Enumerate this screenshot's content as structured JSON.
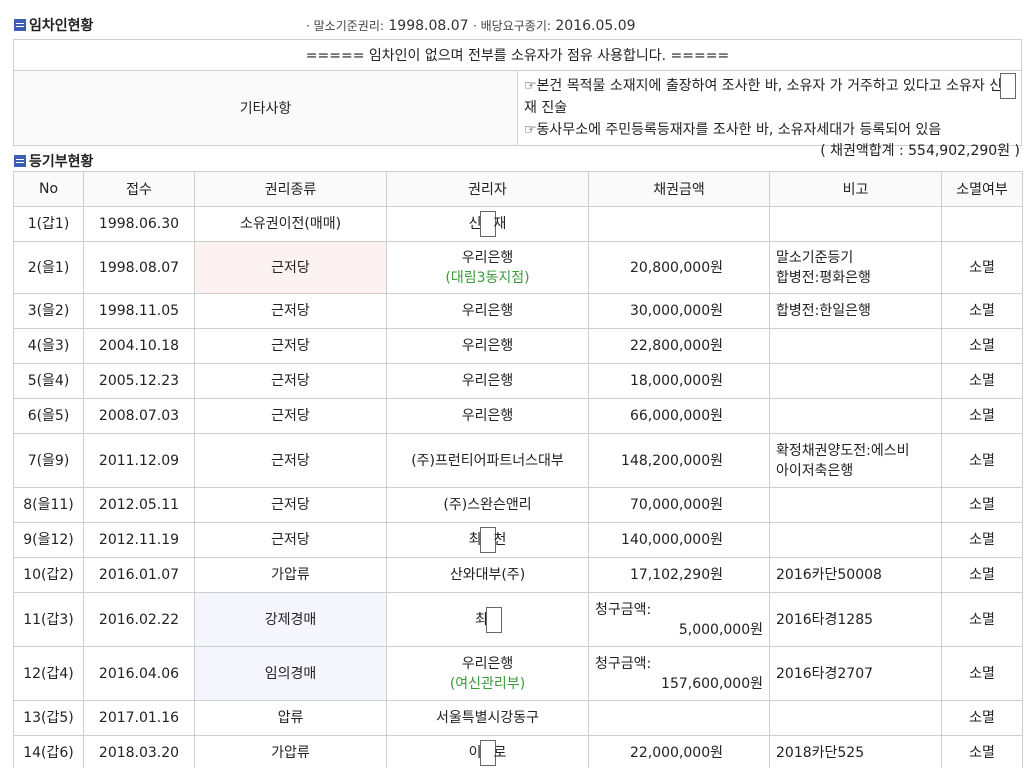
{
  "tenant_section": {
    "title": "임차인현황",
    "dates_label_1": "· 말소기준권리:",
    "dates_value_1": "1998.08.07",
    "dates_label_2": "· 배당요구종기:",
    "dates_value_2": "2016.05.09",
    "notice": "===== 임차인이 없으며 전부를 소유자가 점유 사용합니다. =====",
    "etc_label": "기타사항",
    "etc_line1_pre": "☞본건 목적물 소재지에 출장하여 조사한 바, 소유자 가 거주하고 있다고 소유자 신",
    "etc_line1_post": "재 진술",
    "etc_line2": "☞동사무소에 주민등록등재자를 조사한 바, 소유자세대가 등록되어 있음"
  },
  "registry_section": {
    "title": "등기부현황",
    "total": "( 채권액합계 : 554,902,290원 )",
    "columns": [
      "No",
      "접수",
      "권리종류",
      "권리자",
      "채권금액",
      "비고",
      "소멸여부"
    ],
    "rows": [
      {
        "no": "1(갑1)",
        "date": "1998.06.30",
        "type": "소유권이전(매매)",
        "holder_a": "신",
        "holder_b": "재",
        "holder_sub": "",
        "amount": "",
        "claim_label": "",
        "note1": "",
        "note2": "",
        "status": ""
      },
      {
        "no": "2(을1)",
        "date": "1998.08.07",
        "type": "근저당",
        "holder": "우리은행",
        "holder_sub": "(대림3동지점)",
        "amount": "20,800,000원",
        "claim_label": "",
        "note1": "말소기준등기",
        "note2": "합병전:평화은행",
        "status": "소멸"
      },
      {
        "no": "3(을2)",
        "date": "1998.11.05",
        "type": "근저당",
        "holder": "우리은행",
        "holder_sub": "",
        "amount": "30,000,000원",
        "claim_label": "",
        "note1": "합병전:한일은행",
        "note2": "",
        "status": "소멸"
      },
      {
        "no": "4(을3)",
        "date": "2004.10.18",
        "type": "근저당",
        "holder": "우리은행",
        "holder_sub": "",
        "amount": "22,800,000원",
        "claim_label": "",
        "note1": "",
        "note2": "",
        "status": "소멸"
      },
      {
        "no": "5(을4)",
        "date": "2005.12.23",
        "type": "근저당",
        "holder": "우리은행",
        "holder_sub": "",
        "amount": "18,000,000원",
        "claim_label": "",
        "note1": "",
        "note2": "",
        "status": "소멸"
      },
      {
        "no": "6(을5)",
        "date": "2008.07.03",
        "type": "근저당",
        "holder": "우리은행",
        "holder_sub": "",
        "amount": "66,000,000원",
        "claim_label": "",
        "note1": "",
        "note2": "",
        "status": "소멸"
      },
      {
        "no": "7(을9)",
        "date": "2011.12.09",
        "type": "근저당",
        "holder": "(주)프런티어파트너스대부",
        "holder_sub": "",
        "amount": "148,200,000원",
        "claim_label": "",
        "note1": "확정채권양도전:에스비",
        "note2": "아이저축은행",
        "status": "소멸"
      },
      {
        "no": "8(을11)",
        "date": "2012.05.11",
        "type": "근저당",
        "holder": "(주)스완슨앤리",
        "holder_sub": "",
        "amount": "70,000,000원",
        "claim_label": "",
        "note1": "",
        "note2": "",
        "status": "소멸"
      },
      {
        "no": "9(을12)",
        "date": "2012.11.19",
        "type": "근저당",
        "holder_a": "최",
        "holder_b": "천",
        "holder_sub": "",
        "amount": "140,000,000원",
        "claim_label": "",
        "note1": "",
        "note2": "",
        "status": "소멸"
      },
      {
        "no": "10(갑2)",
        "date": "2016.01.07",
        "type": "가압류",
        "holder": "산와대부(주)",
        "holder_sub": "",
        "amount": "17,102,290원",
        "claim_label": "",
        "note1": "2016카단50008",
        "note2": "",
        "status": "소멸"
      },
      {
        "no": "11(갑3)",
        "date": "2016.02.22",
        "type": "강제경매",
        "holder_a": "최",
        "holder_b": "",
        "holder_sub": "",
        "amount": "5,000,000원",
        "claim_label": "청구금액:",
        "note1": "2016타경1285",
        "note2": "",
        "status": "소멸"
      },
      {
        "no": "12(갑4)",
        "date": "2016.04.06",
        "type": "임의경매",
        "holder": "우리은행",
        "holder_sub": "(여신관리부)",
        "amount": "157,600,000원",
        "claim_label": "청구금액:",
        "note1": "2016타경2707",
        "note2": "",
        "status": "소멸"
      },
      {
        "no": "13(갑5)",
        "date": "2017.01.16",
        "type": "압류",
        "holder": "서울특별시강동구",
        "holder_sub": "",
        "amount": "",
        "claim_label": "",
        "note1": "",
        "note2": "",
        "status": "소멸"
      },
      {
        "no": "14(갑6)",
        "date": "2018.03.20",
        "type": "가압류",
        "holder_a": "이",
        "holder_b": "로",
        "holder_sub": "",
        "amount": "22,000,000원",
        "claim_label": "",
        "note1": "2018카단525",
        "note2": "",
        "status": "소멸"
      }
    ]
  }
}
